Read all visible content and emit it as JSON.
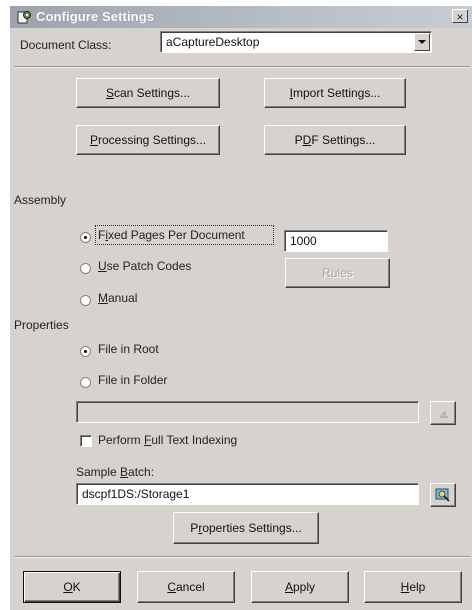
{
  "window": {
    "title": "Configure Settings",
    "close_glyph": "×"
  },
  "document_class": {
    "label": "Document Class:",
    "value": "aCaptureDesktop"
  },
  "buttons": {
    "scan_settings": {
      "pre": "",
      "key": "S",
      "post": "can Settings..."
    },
    "import_settings": {
      "pre": "",
      "key": "I",
      "post": "mport Settings..."
    },
    "processing_settings": {
      "pre": "",
      "key": "P",
      "post": "rocessing Settings..."
    },
    "pdf_settings": {
      "pre": "P",
      "key": "D",
      "post": "F Settings..."
    }
  },
  "assembly": {
    "label": "Assembly",
    "fixed_pages": {
      "pre": "F",
      "key": "i",
      "post": "xed Pages Per Document",
      "checked": true
    },
    "fixed_pages_value": "1000",
    "use_patch_codes": {
      "pre": "",
      "key": "U",
      "post": "se Patch Codes",
      "checked": false
    },
    "rules_label": "Rules",
    "manual": {
      "pre": "",
      "key": "M",
      "post": "anual",
      "checked": false
    }
  },
  "properties": {
    "label": "Properties",
    "file_in_root": {
      "text": "File in Root",
      "checked": true
    },
    "file_in_folder": {
      "text": "File in Folder",
      "checked": false
    },
    "folder_value": "",
    "full_text": {
      "pre": "Perform ",
      "key": "F",
      "post": "ull Text Indexing",
      "checked": false
    },
    "sample_batch_label": {
      "pre": "Sample ",
      "key": "B",
      "post": "atch:"
    },
    "sample_batch_value": "dscpf1DS:/Storage1",
    "properties_settings": {
      "pre": "P",
      "key": "r",
      "post": "operties Settings..."
    }
  },
  "footer": {
    "ok": {
      "key": "O",
      "post": "K"
    },
    "cancel": {
      "key": "C",
      "post": "ancel"
    },
    "apply": {
      "key": "A",
      "post": "pply"
    },
    "help": {
      "key": "H",
      "post": "elp"
    }
  },
  "colors": {
    "face": "#d6d3ce",
    "titlebar": "#9da3ad",
    "field": "#ffffff"
  },
  "icons": [
    "settings-app-icon",
    "close-icon",
    "dropdown-arrow-icon",
    "browse-folder-icon",
    "browse-batch-icon"
  ]
}
